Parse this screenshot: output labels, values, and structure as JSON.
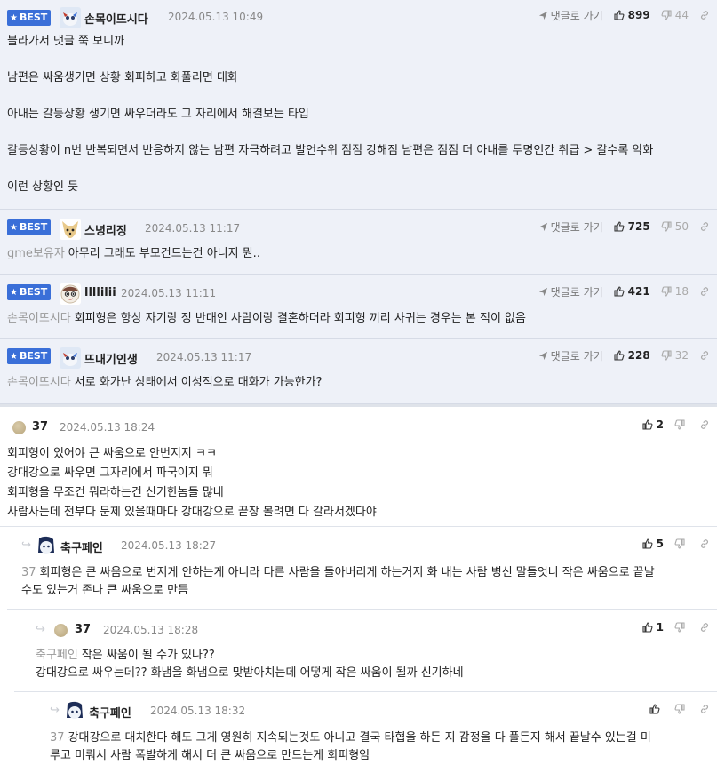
{
  "common": {
    "best_label": "BEST",
    "reply_link_label": "댓글로 가기"
  },
  "best_comments": [
    {
      "nickname": "손목이뜨시다",
      "date": "2024.05.13 10:49",
      "likes": "899",
      "dislikes": "44",
      "lines": [
        "블라가서 댓글 쭉 보니까",
        "남편은 싸움생기면 상황 회피하고 화풀리면 대화",
        "아내는 갈등상황 생기면 싸우더라도 그 자리에서 해결보는 타입",
        "갈등상황이 n번 반복되면서 반응하지 않는 남편 자극하려고 발언수위 점점 강해짐 남편은 점점 더 아내를 투명인간 취급 > 갈수록 악화",
        "이런 상황인 듯"
      ]
    },
    {
      "nickname": "스녕리징",
      "date": "2024.05.13 11:17",
      "likes": "725",
      "dislikes": "50",
      "mention": "gme보유자",
      "text": "아무리 그래도 부모건드는건 아니지 뭔.."
    },
    {
      "nickname": "llllilii",
      "date": "2024.05.13 11:11",
      "likes": "421",
      "dislikes": "18",
      "mention": "손목이뜨시다",
      "text": "회피형은 항상 자기랑 정 반대인 사람이랑 결혼하더라 회피형 끼리 사귀는 경우는 본 적이 없음"
    },
    {
      "nickname": "뜨내기인생",
      "date": "2024.05.13 11:17",
      "likes": "228",
      "dislikes": "32",
      "mention": "손목이뜨시다",
      "text": "서로 화가난 상태에서 이성적으로 대화가 가능한가?"
    }
  ],
  "comments": [
    {
      "nickname": "37",
      "date": "2024.05.13 18:24",
      "likes": "2",
      "lines": [
        "회피형이 있어야 큰 싸움으로 안번지지 ㅋㅋ",
        "강대강으로 싸우면 그자리에서 파국이지 뭐",
        "회피형을 무조건 뭐라하는건 신기한놈들 많네",
        "사람사는데 전부다 문제 있을때마다 강대강으로 끝장 볼려면 다 갈라서겠다야"
      ]
    },
    {
      "nickname": "축구페인",
      "date": "2024.05.13 18:27",
      "likes": "5",
      "mention": "37",
      "lines": [
        "회피형은 큰 싸움으로 번지게 안하는게 아니라 다른 사람을 돌아버리게 하는거지 화 내는 사람 병신 말들엇니 작은 싸움으로 끝날",
        "수도 있는거 존나 큰 싸움으로 만듬"
      ]
    },
    {
      "nickname": "37",
      "date": "2024.05.13 18:28",
      "likes": "1",
      "mention": "축구페인",
      "lines": [
        "작은 싸움이 될 수가 있나??",
        "강대강으로 싸우는데?? 화냄을 화냄으로 맞받아치는데 어떻게 작은 싸움이 될까 신기하네"
      ]
    },
    {
      "nickname": "축구페인",
      "date": "2024.05.13 18:32",
      "likes": "",
      "mention": "37",
      "lines": [
        "강대강으로 대치한다 해도 그게 영원히 지속되는것도 아니고 결국 타협을 하든 지 감정을 다 풀든지 해서 끝날수 있는걸 미",
        "루고 미뤄서 사람 폭발하게 해서 더 큰 싸움으로 만드는게 회피형임"
      ]
    }
  ]
}
